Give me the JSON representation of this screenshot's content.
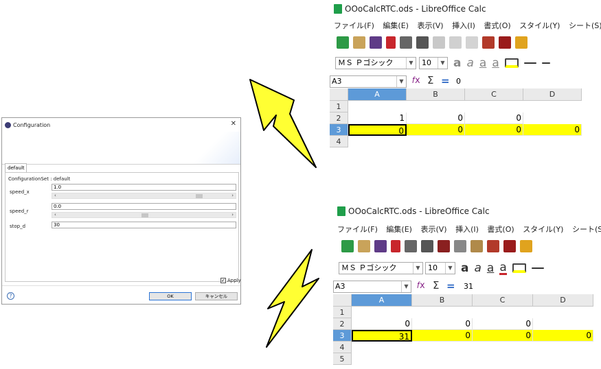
{
  "dialog": {
    "title": "Configuration",
    "close": "✕",
    "tab": "default",
    "config_set": "ConfigurationSet : default",
    "speed_x_label": "speed_x",
    "speed_x_value": "1.0",
    "speed_r_label": "speed_r",
    "speed_r_value": "0.0",
    "stop_d_label": "stop_d",
    "stop_d_value": "30",
    "apply_label": "Apply",
    "ok_label": "OK",
    "cancel_label": "キャンセル",
    "help_glyph": "?",
    "scroll_left": "‹",
    "scroll_right": "›"
  },
  "calc_top": {
    "title": "OOoCalcRTC.ods - LibreOffice Calc",
    "menu": [
      "ファイル(F)",
      "編集(E)",
      "表示(V)",
      "挿入(I)",
      "書式(O)",
      "スタイル(Y)",
      "シート(S)"
    ],
    "font_name": "ＭＳ Ｐゴシック",
    "font_size": "10",
    "name_box": "A3",
    "formula": "0",
    "columns": [
      "A",
      "B",
      "C",
      "D"
    ],
    "rows": [
      "1",
      "2",
      "3",
      "4"
    ],
    "row2": [
      "1",
      "0",
      "0",
      ""
    ],
    "row3": [
      "0",
      "0",
      "0",
      "0"
    ]
  },
  "calc_bottom": {
    "title": "OOoCalcRTC.ods - LibreOffice Calc",
    "menu": [
      "ファイル(F)",
      "編集(E)",
      "表示(V)",
      "挿入(I)",
      "書式(O)",
      "スタイル(Y)",
      "シート(S"
    ],
    "font_name": "ＭＳ Ｐゴシック",
    "font_size": "10",
    "name_box": "A3",
    "formula": "31",
    "columns": [
      "A",
      "B",
      "C",
      "D"
    ],
    "rows": [
      "1",
      "2",
      "3",
      "4",
      "5"
    ],
    "row2": [
      "0",
      "0",
      "0",
      ""
    ],
    "row3": [
      "31",
      "0",
      "0",
      "0"
    ]
  },
  "colors": {
    "highlight": "#ffff00",
    "arrow_fill": "#ffff33",
    "selected_header": "#5d9ad8"
  }
}
